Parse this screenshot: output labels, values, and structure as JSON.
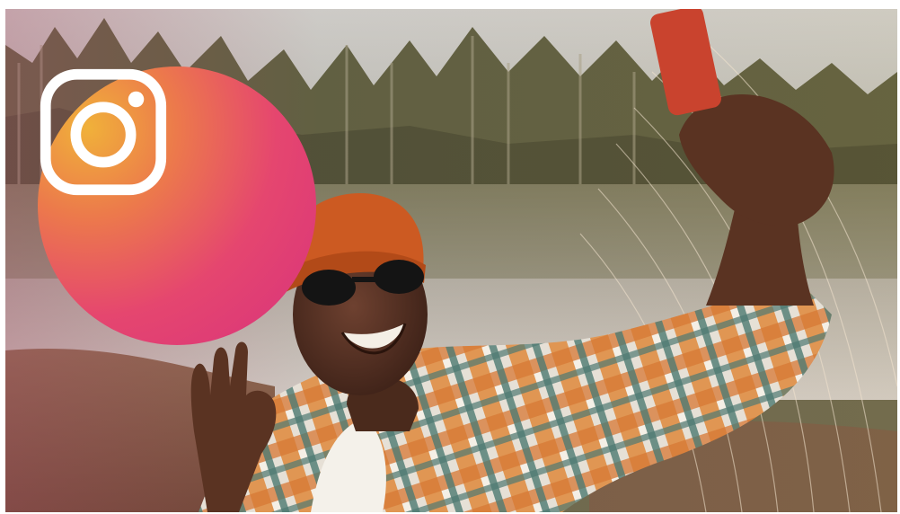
{
  "scene": {
    "description_icon": "instagram-icon"
  },
  "colors": {
    "badge_gradient": [
      "#f0b13a",
      "#ec7a4b",
      "#e5466f",
      "#d8327c"
    ],
    "hat": "#cc5a22",
    "shirt_orange": "#e08a3c",
    "shirt_teal": "#4e7a72",
    "phone": "#c9432e",
    "skin": "#5a3322",
    "lake": "#b9b7ae",
    "forest": "#5d6140"
  }
}
